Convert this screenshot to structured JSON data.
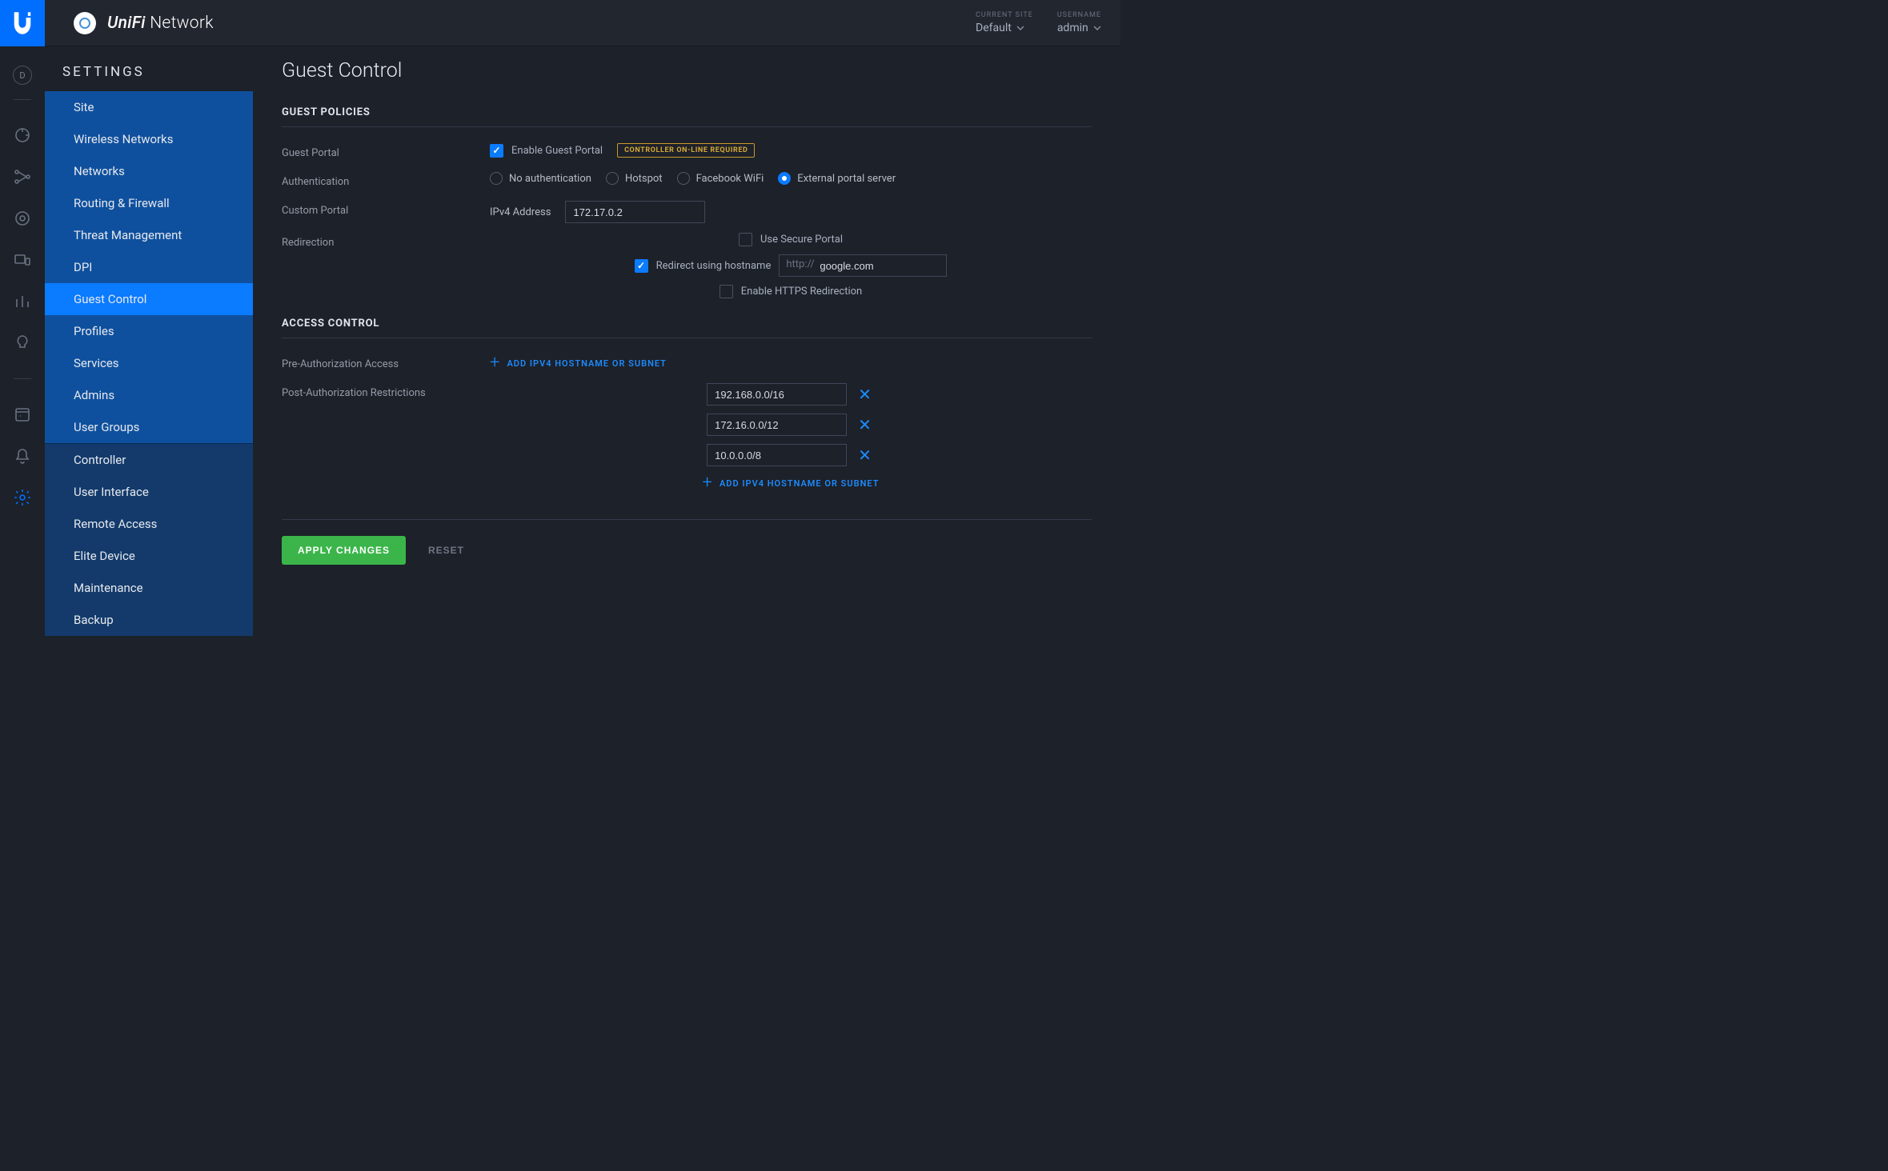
{
  "header": {
    "brand_bold": "UniFi",
    "brand_light": "Network",
    "site_label": "CURRENT SITE",
    "site_value": "Default",
    "user_label": "USERNAME",
    "user_value": "admin"
  },
  "rail_badge": "D",
  "sidebar": {
    "title": "SETTINGS",
    "group1": [
      "Site",
      "Wireless Networks",
      "Networks",
      "Routing & Firewall",
      "Threat Management",
      "DPI",
      "Guest Control",
      "Profiles",
      "Services",
      "Admins",
      "User Groups"
    ],
    "group2": [
      "Controller",
      "User Interface",
      "Remote Access",
      "Elite Device",
      "Maintenance",
      "Backup"
    ],
    "active": "Guest Control"
  },
  "page": {
    "title": "Guest Control",
    "policies_heading": "GUEST POLICIES",
    "row_guest_portal": "Guest Portal",
    "enable_guest_portal": "Enable Guest Portal",
    "badge_warn": "CONTROLLER ON-LINE REQUIRED",
    "row_auth": "Authentication",
    "auth_opts": [
      "No authentication",
      "Hotspot",
      "Facebook WiFi",
      "External portal server"
    ],
    "auth_selected": "External portal server",
    "row_custom": "Custom Portal",
    "ipv4_label": "IPv4 Address",
    "ipv4_value": "172.17.0.2",
    "row_redir": "Redirection",
    "use_secure": "Use Secure Portal",
    "redir_host": "Redirect using hostname",
    "redir_url_prefix": "http://",
    "redir_url_value": "google.com",
    "enable_https": "Enable HTTPS Redirection",
    "access_heading": "ACCESS CONTROL",
    "pre_auth": "Pre-Authorization Access",
    "post_auth": "Post-Authorization Restrictions",
    "add_link": "ADD IPV4 HOSTNAME OR SUBNET",
    "restrictions": [
      "192.168.0.0/16",
      "172.16.0.0/12",
      "10.0.0.0/8"
    ],
    "apply": "APPLY CHANGES",
    "reset": "RESET"
  }
}
